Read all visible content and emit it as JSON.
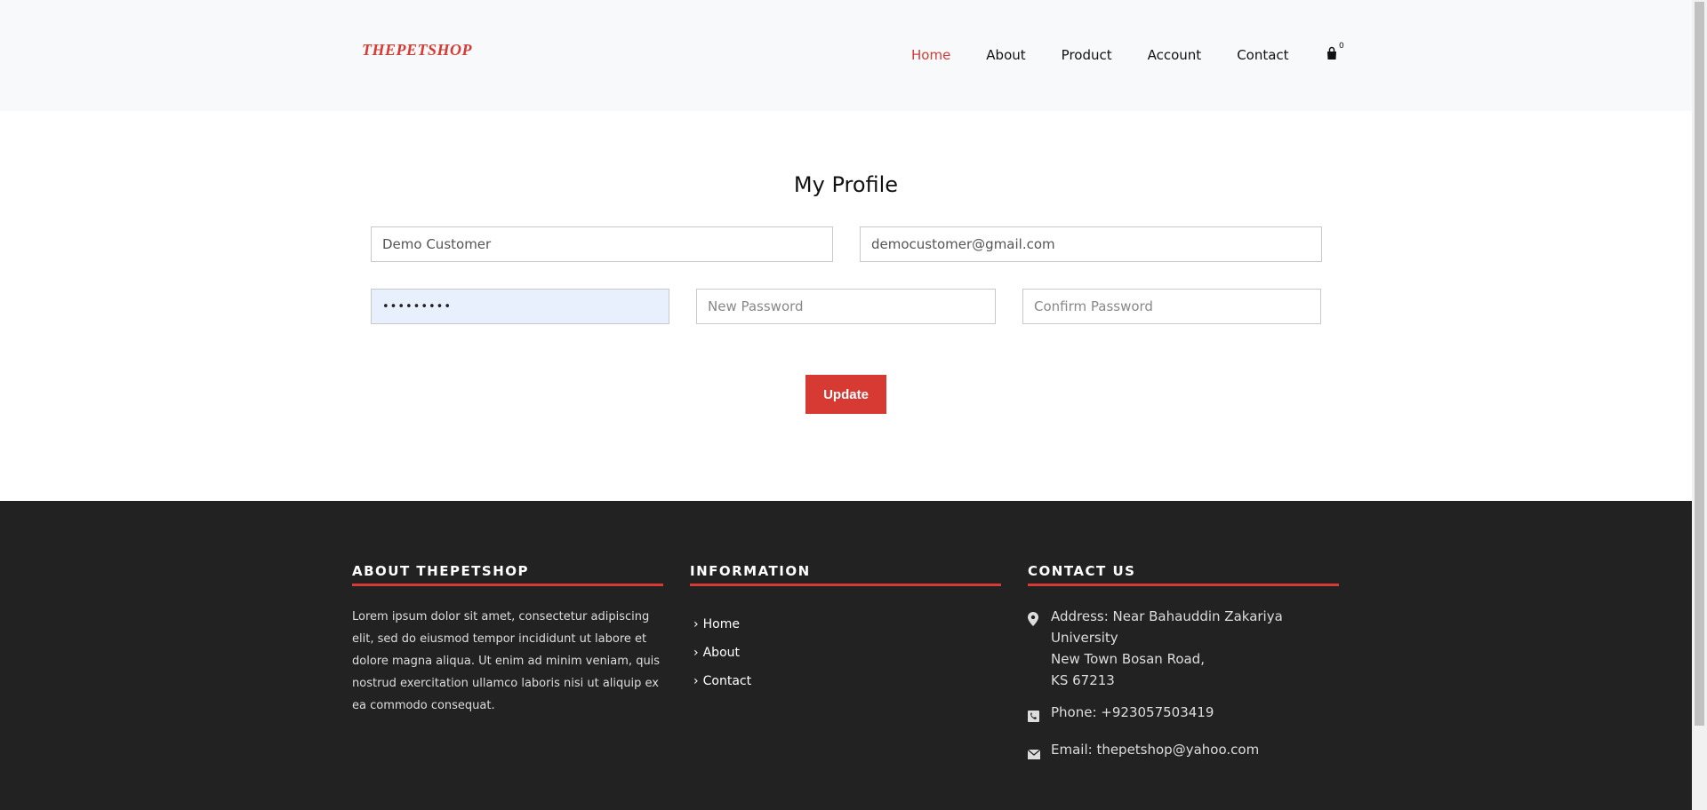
{
  "header": {
    "logo": "THEPETSHOP",
    "nav": [
      "Home",
      "About",
      "Product",
      "Account",
      "Contact"
    ],
    "cart_count": "0",
    "accent_color": "#d63a33"
  },
  "main": {
    "title": "My Profile",
    "name_value": "Demo Customer",
    "email_value": "democustomer@gmail.com",
    "current_password_value": "•••••••••",
    "new_password_placeholder": "New Password",
    "confirm_password_placeholder": "Confirm Password",
    "update_label": "Update"
  },
  "footer": {
    "about_title": "ABOUT THEPETSHOP",
    "about_text": "Lorem ipsum dolor sit amet, consectetur adipiscing elit, sed do eiusmod tempor incididunt ut labore et dolore magna aliqua. Ut enim ad minim veniam, quis nostrud exercitation ullamco laboris nisi ut aliquip ex ea commodo consequat.",
    "info_title": "INFORMATION",
    "info_links": [
      "Home",
      "About",
      "Contact"
    ],
    "contact_title": "CONTACT US",
    "address_lines": [
      "Address: Near Bahauddin Zakariya",
      "University",
      "New Town Bosan Road,",
      "KS 67213"
    ],
    "phone": "Phone: +923057503419",
    "email": "Email: thepetshop@yahoo.com"
  }
}
